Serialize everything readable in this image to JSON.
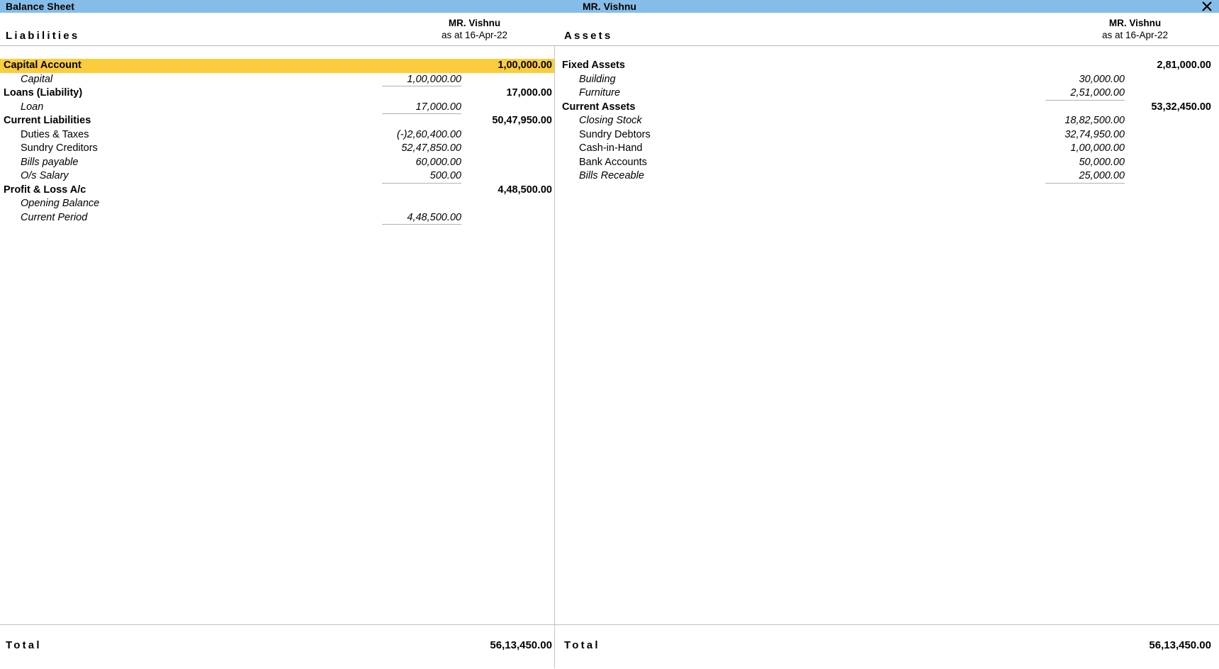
{
  "titlebar": {
    "title": "Balance Sheet",
    "company": "MR. Vishnu",
    "close_label": "✕"
  },
  "colors": {
    "titlebar_bg": "#86bde8",
    "highlight_bg": "#fbcd3c",
    "divider": "#c6c6c6",
    "text": "#000000"
  },
  "header": {
    "left": {
      "side_label": "Liabilities",
      "company": "MR. Vishnu",
      "period": "as at 16-Apr-22"
    },
    "right": {
      "side_label": "Assets",
      "company": "MR. Vishnu",
      "period": "as at 16-Apr-22"
    }
  },
  "liabilities": [
    {
      "name": "Capital Account",
      "value": "1,00,000.00",
      "type": "group",
      "highlight": true
    },
    {
      "name": "Capital",
      "value": "1,00,000.00",
      "type": "ledger",
      "italic": true,
      "ruled": true
    },
    {
      "name": "Loans (Liability)",
      "value": "17,000.00",
      "type": "group"
    },
    {
      "name": "Loan",
      "value": "17,000.00",
      "type": "ledger",
      "italic": true,
      "ruled": true
    },
    {
      "name": "Current Liabilities",
      "value": "50,47,950.00",
      "type": "group"
    },
    {
      "name": "Duties & Taxes",
      "value": "(-)2,60,400.00",
      "type": "ledger",
      "italic": false
    },
    {
      "name": "Sundry Creditors",
      "value": "52,47,850.00",
      "type": "ledger",
      "italic": false
    },
    {
      "name": "Bills payable",
      "value": "60,000.00",
      "type": "ledger",
      "italic": true
    },
    {
      "name": "O/s Salary",
      "value": "500.00",
      "type": "ledger",
      "italic": true,
      "ruled": true
    },
    {
      "name": "Profit & Loss A/c",
      "value": "4,48,500.00",
      "type": "group"
    },
    {
      "name": "Opening Balance",
      "value": "",
      "type": "ledger",
      "italic": true
    },
    {
      "name": "Current Period",
      "value": "4,48,500.00",
      "type": "ledger",
      "italic": true,
      "ruled": true
    }
  ],
  "assets": [
    {
      "name": "Fixed Assets",
      "value": "2,81,000.00",
      "type": "group"
    },
    {
      "name": "Building",
      "value": "30,000.00",
      "type": "ledger",
      "italic": true
    },
    {
      "name": "Furniture",
      "value": "2,51,000.00",
      "type": "ledger",
      "italic": true,
      "ruled": true
    },
    {
      "name": "Current Assets",
      "value": "53,32,450.00",
      "type": "group"
    },
    {
      "name": "Closing Stock",
      "value": "18,82,500.00",
      "type": "ledger",
      "italic": true
    },
    {
      "name": "Sundry Debtors",
      "value": "32,74,950.00",
      "type": "ledger",
      "italic": false
    },
    {
      "name": "Cash-in-Hand",
      "value": "1,00,000.00",
      "type": "ledger",
      "italic": false
    },
    {
      "name": "Bank Accounts",
      "value": "50,000.00",
      "type": "ledger",
      "italic": false
    },
    {
      "name": "Bills Receable",
      "value": "25,000.00",
      "type": "ledger",
      "italic": true,
      "ruled": true
    }
  ],
  "totals": {
    "left": {
      "label": "Total",
      "value": "56,13,450.00"
    },
    "right": {
      "label": "Total",
      "value": "56,13,450.00"
    }
  }
}
